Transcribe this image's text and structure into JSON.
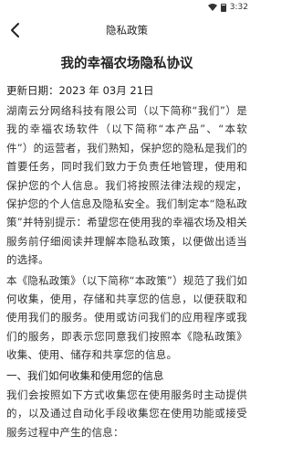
{
  "status_bar": {
    "time": "3:32",
    "icons": [
      "wifi-icon",
      "battery-icon"
    ]
  },
  "header": {
    "back_icon": "chevron-left-icon",
    "title": "隐私政策"
  },
  "document": {
    "title": "我的幸福农场隐私协议",
    "updated": "更新日期：2023 年 03月 21日",
    "paragraphs": [
      "湖南云分网络科技有限公司（以下简称“我们”）是我的幸福农场软件（以下简称“本产品”、“本软件”）的运营者，我们熟知，保护您的隐私是我们的首要任务，同时我们致力于负责任地管理，使用和保护您的个人信息。我们将按照法律法规的规定，保护您的个人信息及隐私安全。我们制定本“隐私政策”并特别提示：希望您在使用我的幸福农场及相关服务前仔细阅读并理解本隐私政策，以便做出适当的选择。",
      "本《隐私政策》（以下简称“本政策”）规范了我们如何收集，使用，存储和共享您的信息，以便获取和使用我们的服务。使用或访问我们的应用程序或我们的服务，即表示您同意我们按照本《隐私政策》收集、使用、储存和共享您的信息。"
    ],
    "section_1_title": "一、我们如何收集和使用您的信息",
    "section_1_text": "我们会按照如下方式收集您在使用服务时主动提供的，以及通过自动化手段收集您在使用功能或接受服务过程中产生的信息："
  }
}
